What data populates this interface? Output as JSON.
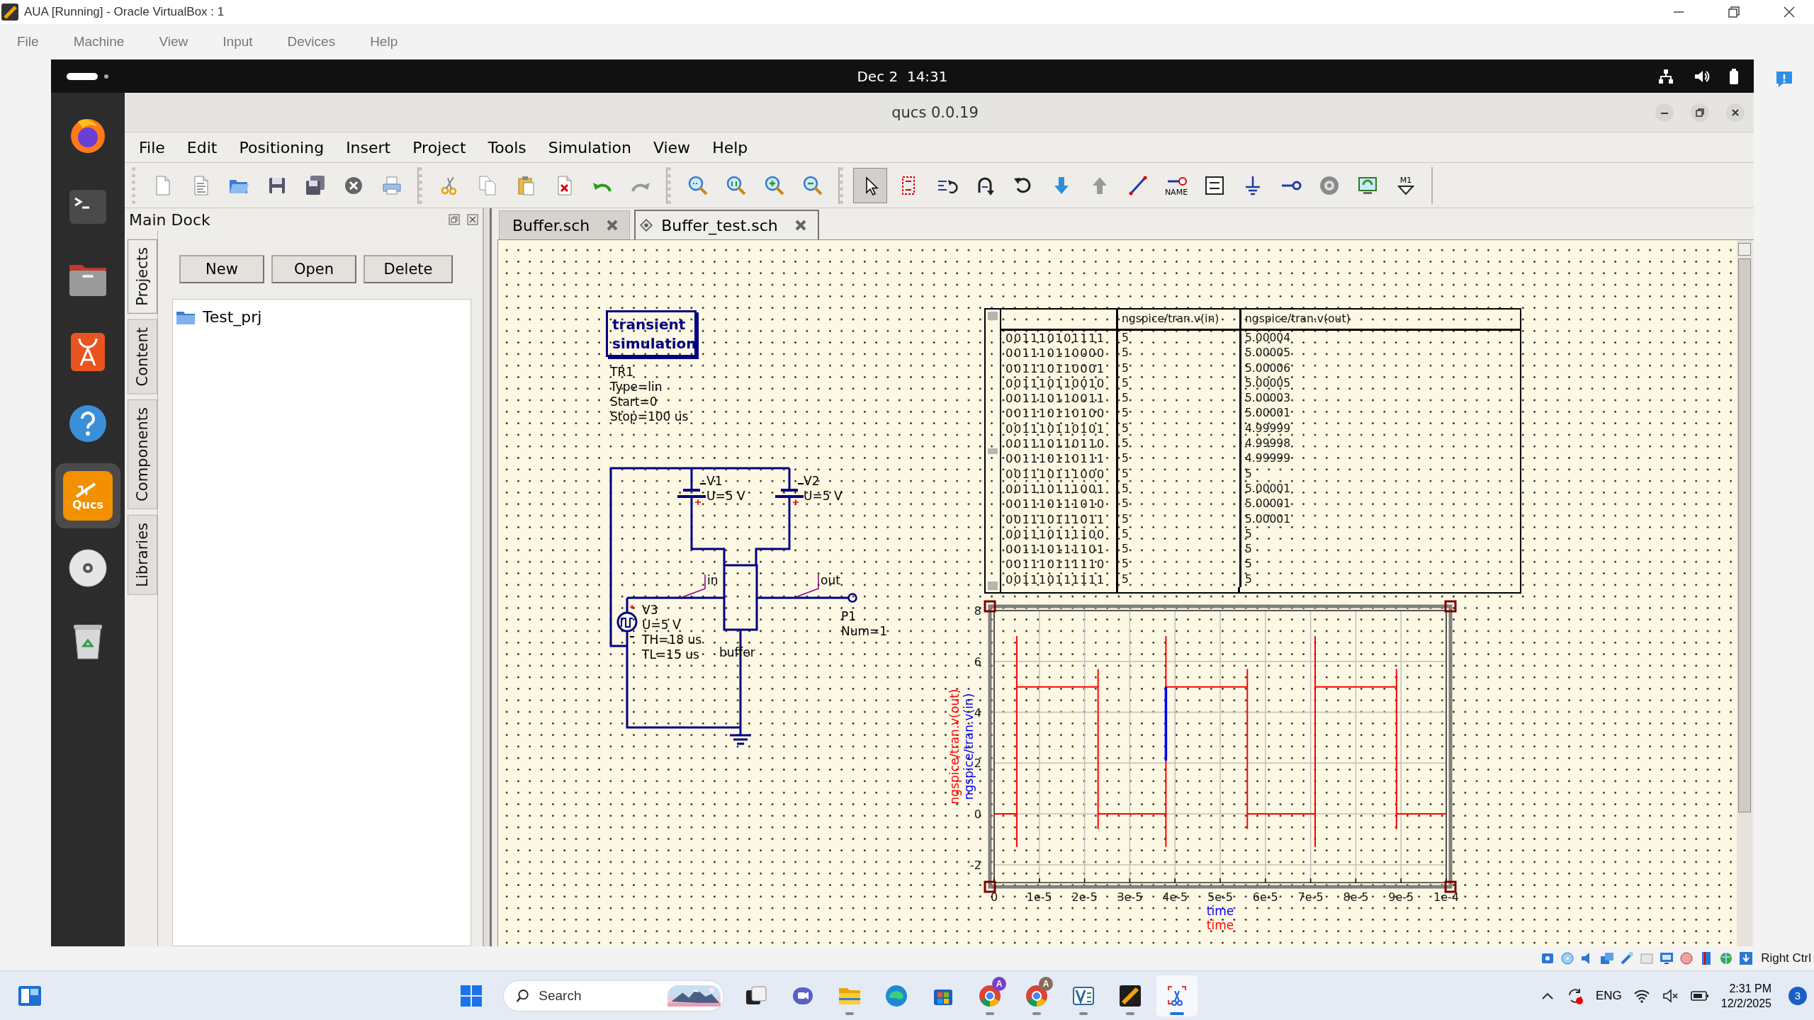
{
  "host_window": {
    "title": "AUA [Running] - Oracle VirtualBox : 1",
    "menu": [
      "File",
      "Machine",
      "View",
      "Input",
      "Devices",
      "Help"
    ]
  },
  "guest_top_bar": {
    "clock": "Dec 2  14:31"
  },
  "dock": [
    {
      "kind": "browser",
      "selected": false
    },
    {
      "kind": "terminal",
      "selected": false
    },
    {
      "kind": "files",
      "selected": false
    },
    {
      "kind": "appstore",
      "selected": false
    },
    {
      "kind": "help",
      "selected": false
    },
    {
      "kind": "qucs",
      "label": "Qucs",
      "selected": true
    },
    {
      "kind": "disc",
      "selected": false
    },
    {
      "kind": "trash",
      "selected": false
    }
  ],
  "qucs": {
    "title": "qucs 0.0.19",
    "menu": [
      "File",
      "Edit",
      "Positioning",
      "Insert",
      "Project",
      "Tools",
      "Simulation",
      "View",
      "Help"
    ],
    "edit_tools": [
      {
        "kind": "cursor",
        "selected": true
      },
      {
        "kind": "dotted_box",
        "selected": false
      },
      {
        "kind": "mirror",
        "selected": false
      },
      {
        "kind": "rotate",
        "selected": false
      },
      {
        "kind": "rotate_left",
        "selected": false
      },
      {
        "kind": "down_arrow",
        "selected": false
      },
      {
        "kind": "up_arrow",
        "selected": false
      },
      {
        "kind": "wire",
        "selected": false
      },
      {
        "kind": "label",
        "label": "NAME",
        "selected": false
      },
      {
        "kind": "equation",
        "selected": false
      },
      {
        "kind": "ground",
        "selected": false
      },
      {
        "kind": "port",
        "selected": false
      },
      {
        "kind": "gear",
        "selected": false
      },
      {
        "kind": "monitor",
        "selected": false
      },
      {
        "kind": "marker",
        "label": "M1",
        "selected": false
      }
    ],
    "main_dock": {
      "title": "Main Dock",
      "side_tabs": [
        {
          "label": "Projects",
          "selected": true
        },
        {
          "label": "Content",
          "selected": false
        },
        {
          "label": "Components",
          "selected": false
        },
        {
          "label": "Libraries",
          "selected": false
        }
      ],
      "buttons": [
        "New",
        "Open",
        "Delete"
      ],
      "projects": [
        "Test_prj"
      ]
    },
    "doc_tabs": [
      {
        "label": "Buffer.sch",
        "selected": false
      },
      {
        "label": "Buffer_test.sch",
        "selected": true
      }
    ],
    "schematic": {
      "simulation": {
        "title": "transient simulation",
        "properties": [
          "TR1",
          "Type=lin",
          "Start=0",
          "Stop=100 us"
        ]
      },
      "components": [
        {
          "kind": "dc_source",
          "labels": [
            "V1",
            "U=5 V"
          ]
        },
        {
          "kind": "dc_source",
          "labels": [
            "V2",
            "U=5 V"
          ]
        },
        {
          "kind": "pulse_source",
          "labels": [
            "V3",
            "U=5 V",
            "TH=18 us",
            "TL=15 us"
          ]
        },
        {
          "kind": "subcircuit",
          "labels": [
            "buffer"
          ]
        },
        {
          "kind": "port",
          "labels": [
            "P1",
            "Num=1"
          ]
        },
        {
          "kind": "ground"
        }
      ],
      "wire_labels": [
        "in",
        "out"
      ]
    },
    "table": {
      "columns": [
        "",
        "ngspice/tran.v(in)",
        "ngspice/tran.v(out)"
      ],
      "rows": [
        [
          "001110101111",
          "5",
          "5.00004"
        ],
        [
          "001110110000",
          "5",
          "5.00005"
        ],
        [
          "001110110001",
          "5",
          "5.00006"
        ],
        [
          "001110110010",
          "5",
          "5.00005"
        ],
        [
          "001110110011",
          "5",
          "5.00003"
        ],
        [
          "001110110100",
          "5",
          "5.00001"
        ],
        [
          "001110110101",
          "5",
          "4.99999"
        ],
        [
          "001110110110",
          "5",
          "4.99998"
        ],
        [
          "001110110111",
          "5",
          "4.99999"
        ],
        [
          "001110111000",
          "5",
          "5"
        ],
        [
          "001110111001",
          "5",
          "5.00001"
        ],
        [
          "001110111010",
          "5",
          "5.00001"
        ],
        [
          "001110111011",
          "5",
          "5.00001"
        ],
        [
          "001110111100",
          "5",
          "5"
        ],
        [
          "001110111101",
          "5",
          "5"
        ],
        [
          "001110111110",
          "5",
          "5"
        ],
        [
          "001110111111",
          "5",
          "5"
        ]
      ]
    },
    "graph": {
      "chart_data": {
        "type": "line",
        "xlabel": "time",
        "x": [
          0,
          5e-06,
          5e-06,
          5e-06,
          5e-06,
          2.3e-05,
          2.3e-05,
          2.3e-05,
          2.3e-05,
          3.8e-05,
          3.8e-05,
          3.8e-05,
          3.8e-05,
          5.6e-05,
          5.6e-05,
          5.6e-05,
          5.6e-05,
          7.1e-05,
          7.1e-05,
          7.1e-05,
          7.1e-05,
          8.9e-05,
          8.9e-05,
          8.9e-05,
          8.9e-05,
          0.0001
        ],
        "series": [
          {
            "name": "ngspice/tran.v(out)",
            "color": "#ff0000",
            "values": [
              0,
              0,
              -1.3,
              7,
              5,
              5,
              5.7,
              -0.6,
              0,
              0,
              -1.3,
              7,
              5,
              5,
              5.7,
              -0.6,
              0,
              0,
              -1.3,
              7,
              5,
              5,
              5.7,
              -0.6,
              0,
              0
            ]
          },
          {
            "name": "ngspice/tran.v(in)",
            "color": "#0000ff",
            "values": [
              null,
              null,
              null,
              null,
              null,
              null,
              null,
              null,
              null,
              null,
              2.1,
              5,
              null,
              null,
              null,
              null,
              null,
              null,
              null,
              null,
              null,
              null,
              null,
              null,
              null,
              null
            ]
          }
        ],
        "xlim": [
          0,
          0.0001
        ],
        "ylim": [
          -2.7,
          8
        ],
        "xticks": [
          {
            "value": 0,
            "label": "0"
          },
          {
            "value": 1e-05,
            "label": "1e-5"
          },
          {
            "value": 2e-05,
            "label": "2e-5"
          },
          {
            "value": 3e-05,
            "label": "3e-5"
          },
          {
            "value": 4e-05,
            "label": "4e-5"
          },
          {
            "value": 5e-05,
            "label": "5e-5"
          },
          {
            "value": 6e-05,
            "label": "6e-5"
          },
          {
            "value": 7e-05,
            "label": "7e-5"
          },
          {
            "value": 8e-05,
            "label": "8e-5"
          },
          {
            "value": 9e-05,
            "label": "9e-5"
          },
          {
            "value": 0.0001,
            "label": "1e-4"
          }
        ],
        "yticks": [
          -2,
          0,
          2,
          4,
          6,
          8
        ],
        "grid": true
      },
      "second_xlabel": "time"
    }
  },
  "vbox_status": {
    "host_key": "Right Ctrl"
  },
  "taskbar": {
    "search": {
      "placeholder": "Search"
    },
    "apps": [
      {
        "kind": "task_view",
        "running": false,
        "selected": false
      },
      {
        "kind": "chat",
        "running": false,
        "selected": false
      },
      {
        "kind": "explorer",
        "running": true,
        "selected": false
      },
      {
        "kind": "edge",
        "running": false,
        "selected": false
      },
      {
        "kind": "store",
        "running": false,
        "selected": false
      },
      {
        "kind": "chrome",
        "badge": "A",
        "color": "#7b3fc4",
        "running": true,
        "selected": false
      },
      {
        "kind": "chrome",
        "badge": "A",
        "color": "#8a6a5a",
        "running": true,
        "selected": false
      },
      {
        "kind": "vs",
        "running": true,
        "selected": false
      },
      {
        "kind": "vbox",
        "running": true,
        "selected": false
      },
      {
        "kind": "snip",
        "running": true,
        "selected": true
      }
    ],
    "tray": {
      "language": "ENG",
      "time": "2:31 PM",
      "date": "12/2/2025",
      "notification_count": "3"
    }
  }
}
